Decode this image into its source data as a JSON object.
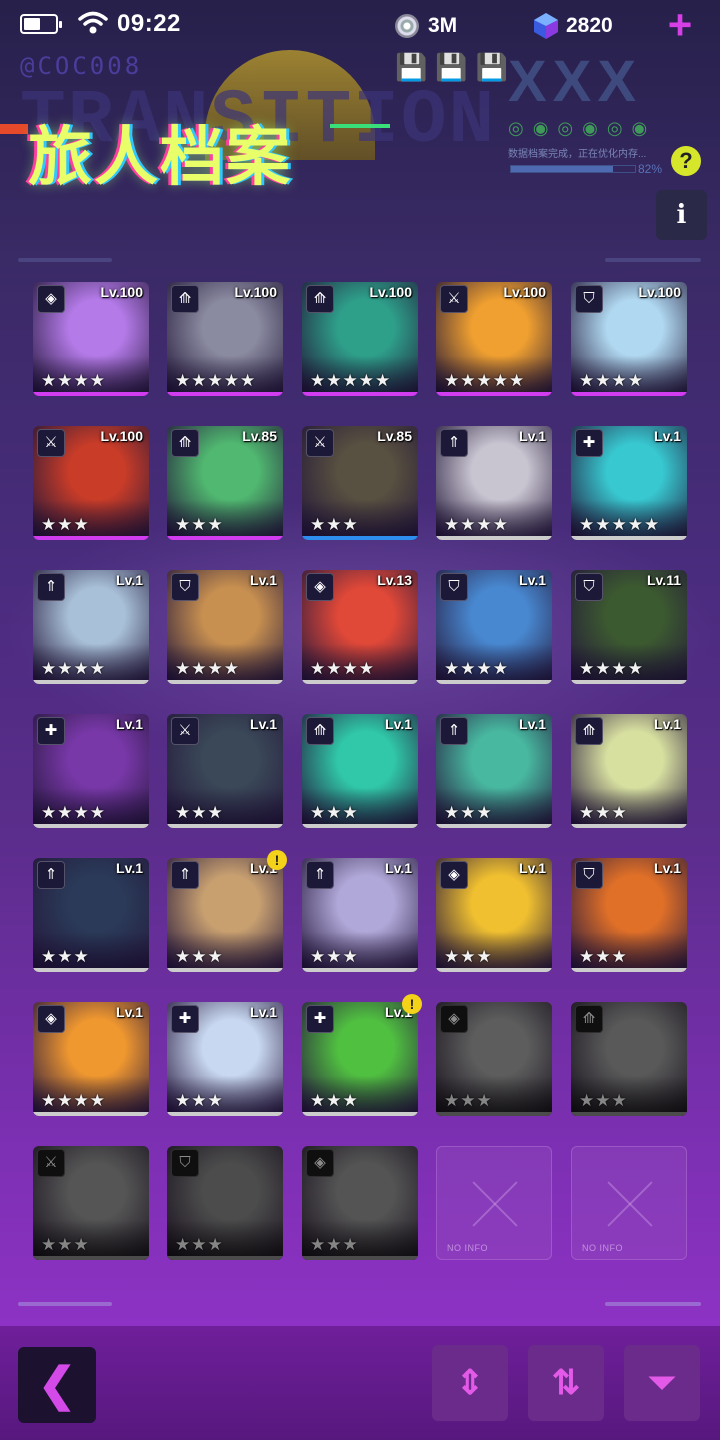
{
  "status": {
    "time": "09:22",
    "coins": "3M",
    "gems": "2820",
    "plus": "+"
  },
  "header": {
    "code": "@COC008",
    "bg_word": "TRANSITION",
    "title": "旅人档案",
    "xxx": "XXX",
    "progress_text": "数据档案完成，正在优化内存...",
    "progress_pct": "82%",
    "progress_value": 0.82,
    "help": "?",
    "info": "i"
  },
  "characters": [
    {
      "lv": "Lv.100",
      "stars": 4,
      "cls": "diamond-icon",
      "color": "#b47ae8",
      "bar": "#d23cf0",
      "state": "owned"
    },
    {
      "lv": "Lv.100",
      "stars": 5,
      "cls": "bow-icon",
      "color": "#8a8aa0",
      "bar": "#d23cf0",
      "state": "owned"
    },
    {
      "lv": "Lv.100",
      "stars": 5,
      "cls": "bow-icon",
      "color": "#2ea08a",
      "bar": "#d23cf0",
      "state": "owned"
    },
    {
      "lv": "Lv.100",
      "stars": 5,
      "cls": "swords-icon",
      "color": "#f0a030",
      "bar": "#d23cf0",
      "state": "owned"
    },
    {
      "lv": "Lv.100",
      "stars": 4,
      "cls": "shield-icon",
      "color": "#b0d8f0",
      "bar": "#d23cf0",
      "state": "owned"
    },
    {
      "lv": "Lv.100",
      "stars": 3,
      "cls": "swords-icon",
      "color": "#c83c28",
      "bar": "#d23cf0",
      "state": "owned"
    },
    {
      "lv": "Lv.85",
      "stars": 3,
      "cls": "bow-icon",
      "color": "#50b870",
      "bar": "#d23cf0",
      "state": "owned"
    },
    {
      "lv": "Lv.85",
      "stars": 3,
      "cls": "swords-icon",
      "color": "#585040",
      "bar": "#2e8ef0",
      "state": "owned"
    },
    {
      "lv": "Lv.1",
      "stars": 4,
      "cls": "spear-icon",
      "color": "#c8c4d0",
      "bar": "#cccccc",
      "state": "owned"
    },
    {
      "lv": "Lv.1",
      "stars": 5,
      "cls": "heal-icon",
      "color": "#38c8d0",
      "bar": "#cccccc",
      "state": "owned"
    },
    {
      "lv": "Lv.1",
      "stars": 4,
      "cls": "spear-icon",
      "color": "#a8c0d8",
      "bar": "#cccccc",
      "state": "owned"
    },
    {
      "lv": "Lv.1",
      "stars": 4,
      "cls": "shield-icon",
      "color": "#c89050",
      "bar": "#cccccc",
      "state": "owned"
    },
    {
      "lv": "Lv.13",
      "stars": 4,
      "cls": "diamond-icon",
      "color": "#e04838",
      "bar": "#cccccc",
      "state": "owned"
    },
    {
      "lv": "Lv.1",
      "stars": 4,
      "cls": "shield-icon",
      "color": "#4888d0",
      "bar": "#cccccc",
      "state": "owned"
    },
    {
      "lv": "Lv.11",
      "stars": 4,
      "cls": "shield-icon",
      "color": "#3c5a30",
      "bar": "#cccccc",
      "state": "owned"
    },
    {
      "lv": "Lv.1",
      "stars": 4,
      "cls": "heal-icon",
      "color": "#7838a8",
      "bar": "#cccccc",
      "state": "owned"
    },
    {
      "lv": "Lv.1",
      "stars": 3,
      "cls": "swords-icon",
      "color": "#3a4858",
      "bar": "#cccccc",
      "state": "owned"
    },
    {
      "lv": "Lv.1",
      "stars": 3,
      "cls": "bow-icon",
      "color": "#30c8a8",
      "bar": "#cccccc",
      "state": "owned"
    },
    {
      "lv": "Lv.1",
      "stars": 3,
      "cls": "spear-icon",
      "color": "#48b8a0",
      "bar": "#cccccc",
      "state": "owned"
    },
    {
      "lv": "Lv.1",
      "stars": 3,
      "cls": "bow-icon",
      "color": "#d8e0a0",
      "bar": "#cccccc",
      "state": "owned"
    },
    {
      "lv": "Lv.1",
      "stars": 3,
      "cls": "spear-icon",
      "color": "#2a3a58",
      "bar": "#cccccc",
      "state": "owned"
    },
    {
      "lv": "Lv.1",
      "stars": 3,
      "cls": "spear-icon",
      "color": "#c8a070",
      "bar": "#cccccc",
      "state": "owned",
      "alert": "!"
    },
    {
      "lv": "Lv.1",
      "stars": 3,
      "cls": "spear-icon",
      "color": "#b0a8d8",
      "bar": "#cccccc",
      "state": "owned"
    },
    {
      "lv": "Lv.1",
      "stars": 3,
      "cls": "diamond-icon",
      "color": "#f0c030",
      "bar": "#cccccc",
      "state": "owned"
    },
    {
      "lv": "Lv.1",
      "stars": 3,
      "cls": "shield-icon",
      "color": "#e07028",
      "bar": "#cccccc",
      "state": "owned"
    },
    {
      "lv": "Lv.1",
      "stars": 4,
      "cls": "diamond-icon",
      "color": "#f09830",
      "bar": "#cccccc",
      "state": "owned"
    },
    {
      "lv": "Lv.1",
      "stars": 3,
      "cls": "heal-icon",
      "color": "#c8d8f0",
      "bar": "#cccccc",
      "state": "owned"
    },
    {
      "lv": "Lv.1",
      "stars": 3,
      "cls": "heal-icon",
      "color": "#50c040",
      "bar": "#cccccc",
      "state": "owned",
      "alert": "!"
    },
    {
      "lv": "",
      "stars": 3,
      "cls": "diamond-icon",
      "color": "#b0a8a0",
      "bar": "#888888",
      "state": "locked"
    },
    {
      "lv": "",
      "stars": 3,
      "cls": "bow-icon",
      "color": "#a8a0a0",
      "bar": "#888888",
      "state": "locked"
    },
    {
      "lv": "",
      "stars": 3,
      "cls": "swords-icon",
      "color": "#9a9a9a",
      "bar": "#888888",
      "state": "locked"
    },
    {
      "lv": "",
      "stars": 3,
      "cls": "shield-icon",
      "color": "#8a8a8a",
      "bar": "#888888",
      "state": "locked"
    },
    {
      "lv": "",
      "stars": 3,
      "cls": "diamond-icon",
      "color": "#999999",
      "bar": "#888888",
      "state": "locked"
    },
    {
      "state": "empty",
      "noinfo": "NO INFO"
    },
    {
      "state": "empty",
      "noinfo": "NO INFO"
    }
  ],
  "class_glyphs": {
    "diamond-icon": "◈",
    "bow-icon": "⟰",
    "swords-icon": "⚔",
    "shield-icon": "⛉",
    "spear-icon": "⇑",
    "heal-icon": "✚"
  },
  "bottom": {
    "back": "❮",
    "sort_order": "⇕",
    "sort_toggle": "⇅",
    "filter": "⏷"
  }
}
